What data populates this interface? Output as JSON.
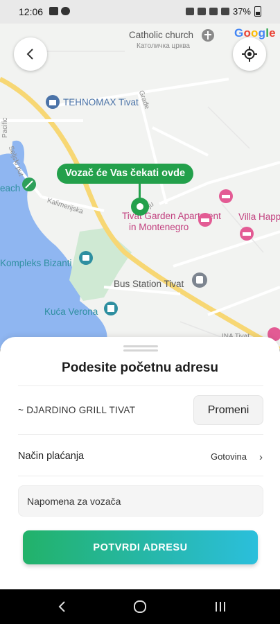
{
  "status_bar": {
    "time": "12:06",
    "battery": "37%"
  },
  "map": {
    "google_logo": "Google",
    "labels": {
      "catholic_church": "Catholic church",
      "catholic_church_cyr": "Католичка црква",
      "tehnomax": "TEHNOMAX Tivat",
      "tivat_garden_1": "Tivat Garden Apartment",
      "tivat_garden_2": "in Montenegro",
      "villa": "Villa Happ",
      "kompleks": "Kompleks Bizanti",
      "bus_station": "Bus Station Tivat",
      "kuca_verona": "Kuća Verona",
      "beach": "each",
      "ina": "INA Tivat",
      "street_kalimerija": "Kalimerijska",
      "street_manju": "Manju",
      "street_pacific": "Pacific",
      "street_seljski": "Seljski put",
      "street_gradi": "Građe"
    },
    "pin_label": "Vozač će Vas čekati ovde",
    "colors": {
      "road_yellow": "#f7d774",
      "park_green": "#cfe9d3",
      "water_blue": "#8fb6f1",
      "pin_green": "#23a04b"
    }
  },
  "controls": {
    "back_icon": "chevron-left-icon",
    "locate_icon": "crosshair-icon"
  },
  "sheet": {
    "title": "Podesite početnu adresu",
    "address": "~ DJARDINO GRILL TIVAT",
    "change_button": "Promeni",
    "payment_label": "Način plaćanja",
    "payment_value": "Gotovina",
    "note_placeholder": "Napomena za vozača",
    "confirm_button": "POTVRDI ADRESU",
    "confirm_gradient": [
      "#22b269",
      "#2bbfdc"
    ]
  },
  "nav_bar": {
    "back": "back-icon",
    "home": "home-icon",
    "recents": "recents-icon"
  }
}
